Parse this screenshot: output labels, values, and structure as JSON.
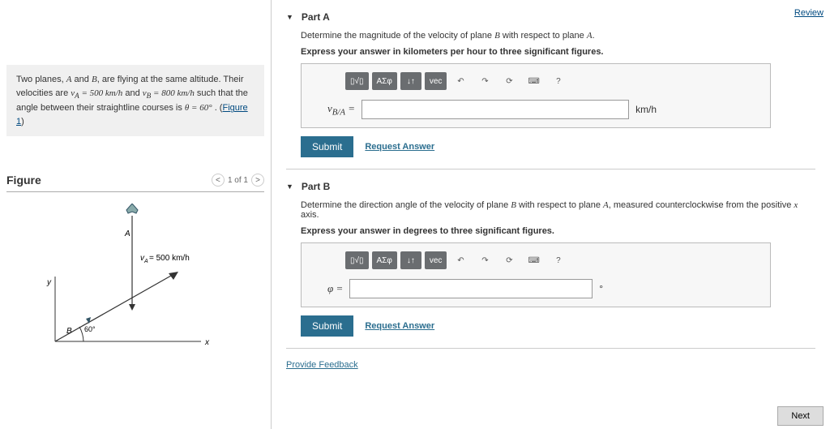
{
  "reviewLabel": "Review",
  "problem": {
    "line1_pre": "Two planes, ",
    "A": "A",
    "and": " and ",
    "B": "B",
    "line1_post": ", are flying at the same altitude. Their",
    "line2_pre": "velocities are ",
    "vA": "v_A = 500 km/h",
    "andtxt": " and ",
    "vB": "v_B = 800 km/h",
    "line2_post": " such that",
    "line3_pre": "the angle between their straightline courses is ",
    "theta": "θ = 60°",
    "dot": " . (",
    "figlink": "Figure 1",
    "end": ")"
  },
  "figure": {
    "heading": "Figure",
    "counter": "1 of 1",
    "captionVA": "v_A = 500 km/h",
    "angle": "60°",
    "axisX": "x",
    "axisY": "y",
    "labelA": "A",
    "labelB": "B"
  },
  "partA": {
    "title": "Part A",
    "prompt": "Determine the magnitude of the velocity of plane B with respect to plane A.",
    "instr": "Express your answer in kilometers per hour to three significant figures.",
    "var": "v_{B/A} =",
    "unit": "km/h"
  },
  "partB": {
    "title": "Part B",
    "prompt": "Determine the direction angle of the velocity of plane B with respect to plane A, measured counterclockwise from the positive x axis.",
    "instr": "Express your answer in degrees to three significant figures.",
    "var": "φ =",
    "unit": "°"
  },
  "tools": {
    "t1": "▯√▯",
    "t2": "ΑΣφ",
    "t3": "↓↑",
    "t4": "vec",
    "undo": "↶",
    "redo": "↷",
    "reset": "⟳",
    "kbd": "⌨",
    "help": "?"
  },
  "buttons": {
    "submit": "Submit",
    "request": "Request Answer",
    "feedback": "Provide Feedback",
    "next": "Next"
  }
}
